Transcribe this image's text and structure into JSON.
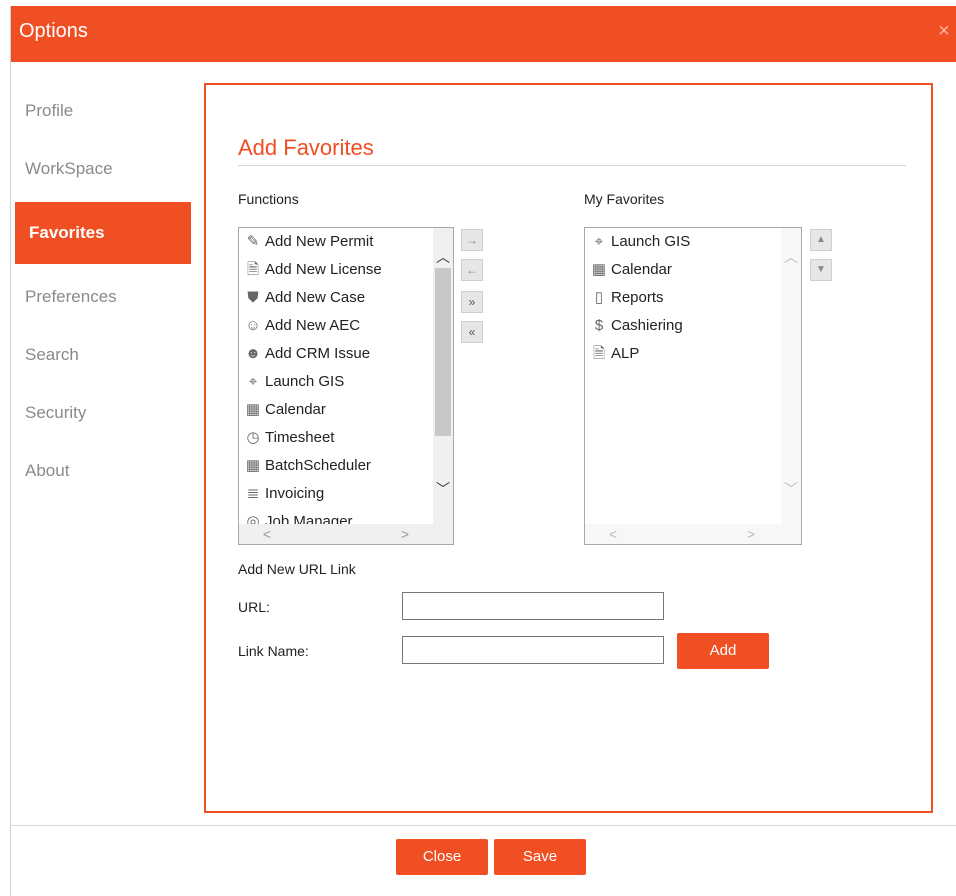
{
  "window": {
    "title": "Options",
    "close_glyph": "×"
  },
  "sidebar": {
    "items": [
      {
        "label": "Profile"
      },
      {
        "label": "WorkSpace"
      },
      {
        "label": "Favorites"
      },
      {
        "label": "Preferences"
      },
      {
        "label": "Search"
      },
      {
        "label": "Security"
      },
      {
        "label": "About"
      }
    ],
    "active": "Favorites"
  },
  "panel": {
    "heading": "Add Favorites",
    "functions_label": "Functions",
    "favorites_label": "My Favorites",
    "functions": [
      {
        "label": "Add New Permit",
        "icon": "permit-icon",
        "glyph": "✎"
      },
      {
        "label": "Add New License",
        "icon": "license-icon",
        "glyph": "🗎"
      },
      {
        "label": "Add New Case",
        "icon": "case-shield-icon",
        "glyph": "⛊"
      },
      {
        "label": "Add New AEC",
        "icon": "aec-worker-icon",
        "glyph": "☺"
      },
      {
        "label": "Add CRM Issue",
        "icon": "crm-issue-icon",
        "glyph": "☻"
      },
      {
        "label": "Launch GIS",
        "icon": "gis-map-icon",
        "glyph": "⌖"
      },
      {
        "label": "Calendar",
        "icon": "calendar-icon",
        "glyph": "▦"
      },
      {
        "label": "Timesheet",
        "icon": "stopwatch-icon",
        "glyph": "◷"
      },
      {
        "label": "BatchScheduler",
        "icon": "calendar-icon",
        "glyph": "▦"
      },
      {
        "label": "Invoicing",
        "icon": "invoice-icon",
        "glyph": "≣"
      },
      {
        "label": "Job Manager",
        "icon": "job-manager-icon",
        "glyph": "◎"
      }
    ],
    "favorites": [
      {
        "label": "Launch GIS",
        "icon": "gis-map-icon",
        "glyph": "⌖"
      },
      {
        "label": "Calendar",
        "icon": "calendar-icon",
        "glyph": "▦"
      },
      {
        "label": "Reports",
        "icon": "bar-chart-icon",
        "glyph": "▯"
      },
      {
        "label": "Cashiering",
        "icon": "dollar-icon",
        "glyph": "$"
      },
      {
        "label": "ALP",
        "icon": "license-icon",
        "glyph": "🗎"
      }
    ],
    "move_buttons": {
      "add_one": "→",
      "remove_one": "←",
      "add_all": "»",
      "remove_all": "«",
      "up": "▲",
      "down": "▼"
    },
    "url_section": {
      "heading": "Add New URL Link",
      "url_label": "URL:",
      "url_value": "",
      "link_name_label": "Link Name:",
      "link_name_value": "",
      "add_button": "Add"
    }
  },
  "footer": {
    "close_button": "Close",
    "save_button": "Save"
  },
  "colors": {
    "accent": "#f04e23"
  }
}
